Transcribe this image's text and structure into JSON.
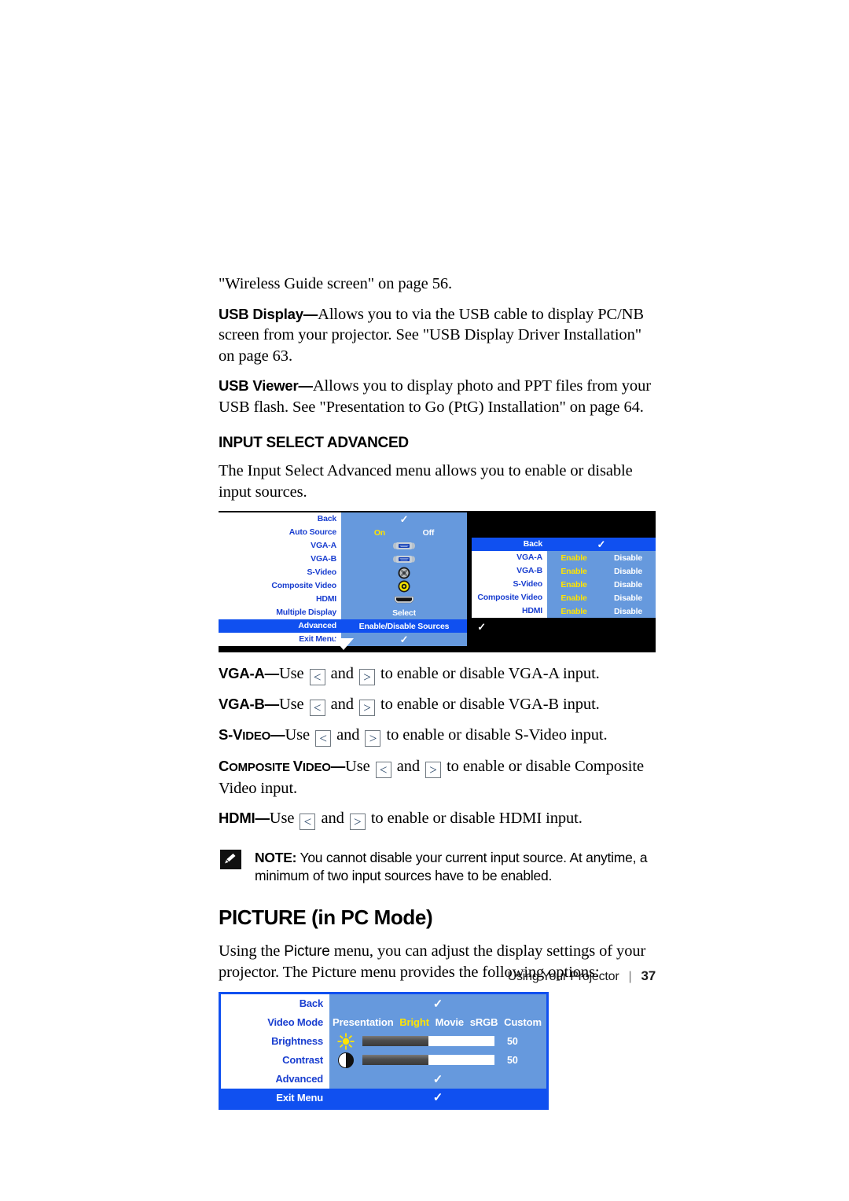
{
  "page": {
    "footer_label": "Using Your Projector",
    "footer_sep": "|",
    "page_number": "37"
  },
  "body": {
    "p_wireless": "\"Wireless Guide screen\" on page 56.",
    "usb_display_lead": "USB Display—",
    "usb_display_text": "Allows you to via the USB cable to display PC/NB screen from your projector. See \"USB Display Driver Installation\" on page 63.",
    "usb_viewer_lead": "USB Viewer—",
    "usb_viewer_text": "Allows you to display photo and PPT files from your USB flash. See \"Presentation to Go (PtG) Installation\" on page 64.",
    "section_heading": "INPUT SELECT ADVANCED",
    "section_intro": "The Input Select Advanced menu allows you to enable or disable input sources.",
    "picture_heading": "PICTURE (in PC Mode)",
    "picture_intro_a": "Using the ",
    "picture_intro_b": "Picture",
    "picture_intro_c": " menu, you can adjust the display settings of your projector. The Picture menu provides the following options:"
  },
  "key_defs": [
    {
      "term_main": "VGA-A",
      "term_small": "",
      "dash": "—",
      "use": "Use",
      "and": "and",
      "tail": "to enable or disable VGA-A input."
    },
    {
      "term_main": "VGA-B",
      "term_small": "",
      "dash": "—",
      "use": "Use",
      "and": "and",
      "tail": "to enable or disable VGA-B input."
    },
    {
      "term_main": "S-V",
      "term_small": "IDEO",
      "dash": "—",
      "use": "Use",
      "and": "and",
      "tail": "to enable or disable S-Video input."
    },
    {
      "term_main": "C",
      "term_small": "OMPOSITE ",
      "term_main2": "V",
      "term_small2": "IDEO",
      "dash": "—",
      "use": "Use",
      "and": "and",
      "tail": "to enable or disable Composite Video input."
    },
    {
      "term_main": "HDMI",
      "term_small": "",
      "dash": "—",
      "use": "Use",
      "and": "and",
      "tail": "to enable or disable HDMI input."
    }
  ],
  "keys": {
    "left": "<",
    "right": ">"
  },
  "note": {
    "label": "NOTE:",
    "text": "You cannot disable your current input source. At anytime, a minimum of two input sources have to be enabled."
  },
  "osd_input_select": {
    "checkmark": "✓",
    "rows": [
      {
        "label": "Back",
        "value_type": "check",
        "value": "✓"
      },
      {
        "label": "Auto Source",
        "value_type": "onoff",
        "on": "On",
        "off": "Off"
      },
      {
        "label": "VGA-A",
        "value_type": "icon",
        "icon": "vga-connector-icon"
      },
      {
        "label": "VGA-B",
        "value_type": "icon",
        "icon": "vga-connector-icon"
      },
      {
        "label": "S-Video",
        "value_type": "icon",
        "icon": "s-video-connector-icon"
      },
      {
        "label": "Composite Video",
        "value_type": "icon",
        "icon": "composite-rca-connector-icon"
      },
      {
        "label": "HDMI",
        "value_type": "icon",
        "icon": "hdmi-connector-icon"
      },
      {
        "label": "Multiple Display",
        "value_type": "text",
        "value": "Select",
        "trailing_check": "✓"
      },
      {
        "label": "Advanced",
        "value_type": "text",
        "value": "Enable/Disable Sources",
        "trailing_check": "✓",
        "highlighted": true
      },
      {
        "label": "Exit Menu",
        "value_type": "check",
        "value": "✓"
      }
    ]
  },
  "osd_enable_disable": {
    "back_label": "Back",
    "back_check": "✓",
    "option_enable": "Enable",
    "option_disable": "Disable",
    "rows": [
      {
        "label": "VGA-A",
        "selected": "Enable"
      },
      {
        "label": "VGA-B",
        "selected": "Enable"
      },
      {
        "label": "S-Video",
        "selected": "Enable"
      },
      {
        "label": "Composite Video",
        "selected": "Enable"
      },
      {
        "label": "HDMI",
        "selected": "Enable"
      }
    ]
  },
  "osd_picture": {
    "back_label": "Back",
    "back_check": "✓",
    "video_mode_label": "Video Mode",
    "video_modes": [
      "Presentation",
      "Bright",
      "Movie",
      "sRGB",
      "Custom"
    ],
    "video_mode_selected": "Bright",
    "brightness_label": "Brightness",
    "brightness_value": "50",
    "brightness_percent": 50,
    "contrast_label": "Contrast",
    "contrast_value": "50",
    "contrast_percent": 50,
    "advanced_label": "Advanced",
    "advanced_check": "✓",
    "exit_label": "Exit Menu",
    "exit_check": "✓"
  },
  "colors": {
    "osd_panel_blue": "#6699dd",
    "osd_highlight_blue": "#1050f0",
    "osd_label_text": "#1a3fd0",
    "osd_selected_yellow": "#ffe400",
    "osd_background_black": "#000000"
  }
}
